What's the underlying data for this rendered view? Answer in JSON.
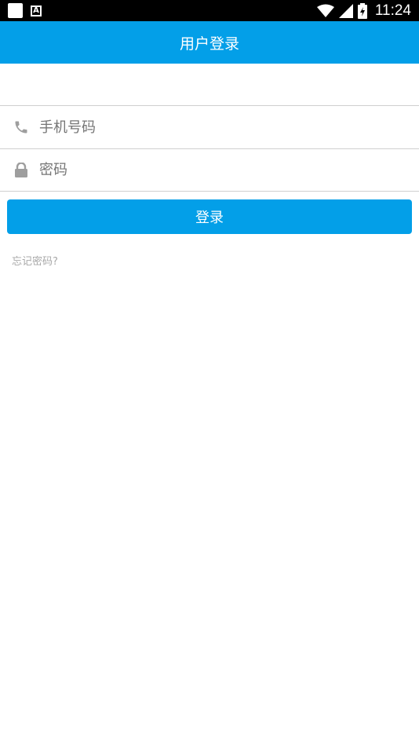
{
  "status_bar": {
    "time": "11:24",
    "left_icons": [
      "square-notification-icon",
      "a-notification-icon"
    ],
    "right_icons": [
      "wifi-icon",
      "signal-icon",
      "battery-charging-icon"
    ]
  },
  "app_bar": {
    "title": "用户登录"
  },
  "form": {
    "phone": {
      "icon": "phone-icon",
      "placeholder": "手机号码",
      "value": ""
    },
    "password": {
      "icon": "lock-icon",
      "placeholder": "密码",
      "value": ""
    }
  },
  "login_button": {
    "label": "登录"
  },
  "forgot_password": {
    "label": "忘记密码?"
  },
  "colors": {
    "accent": "#039fe8",
    "divider": "#cfcfcf",
    "icon_gray": "#9e9e9e",
    "link_gray": "#a8a8a8"
  }
}
